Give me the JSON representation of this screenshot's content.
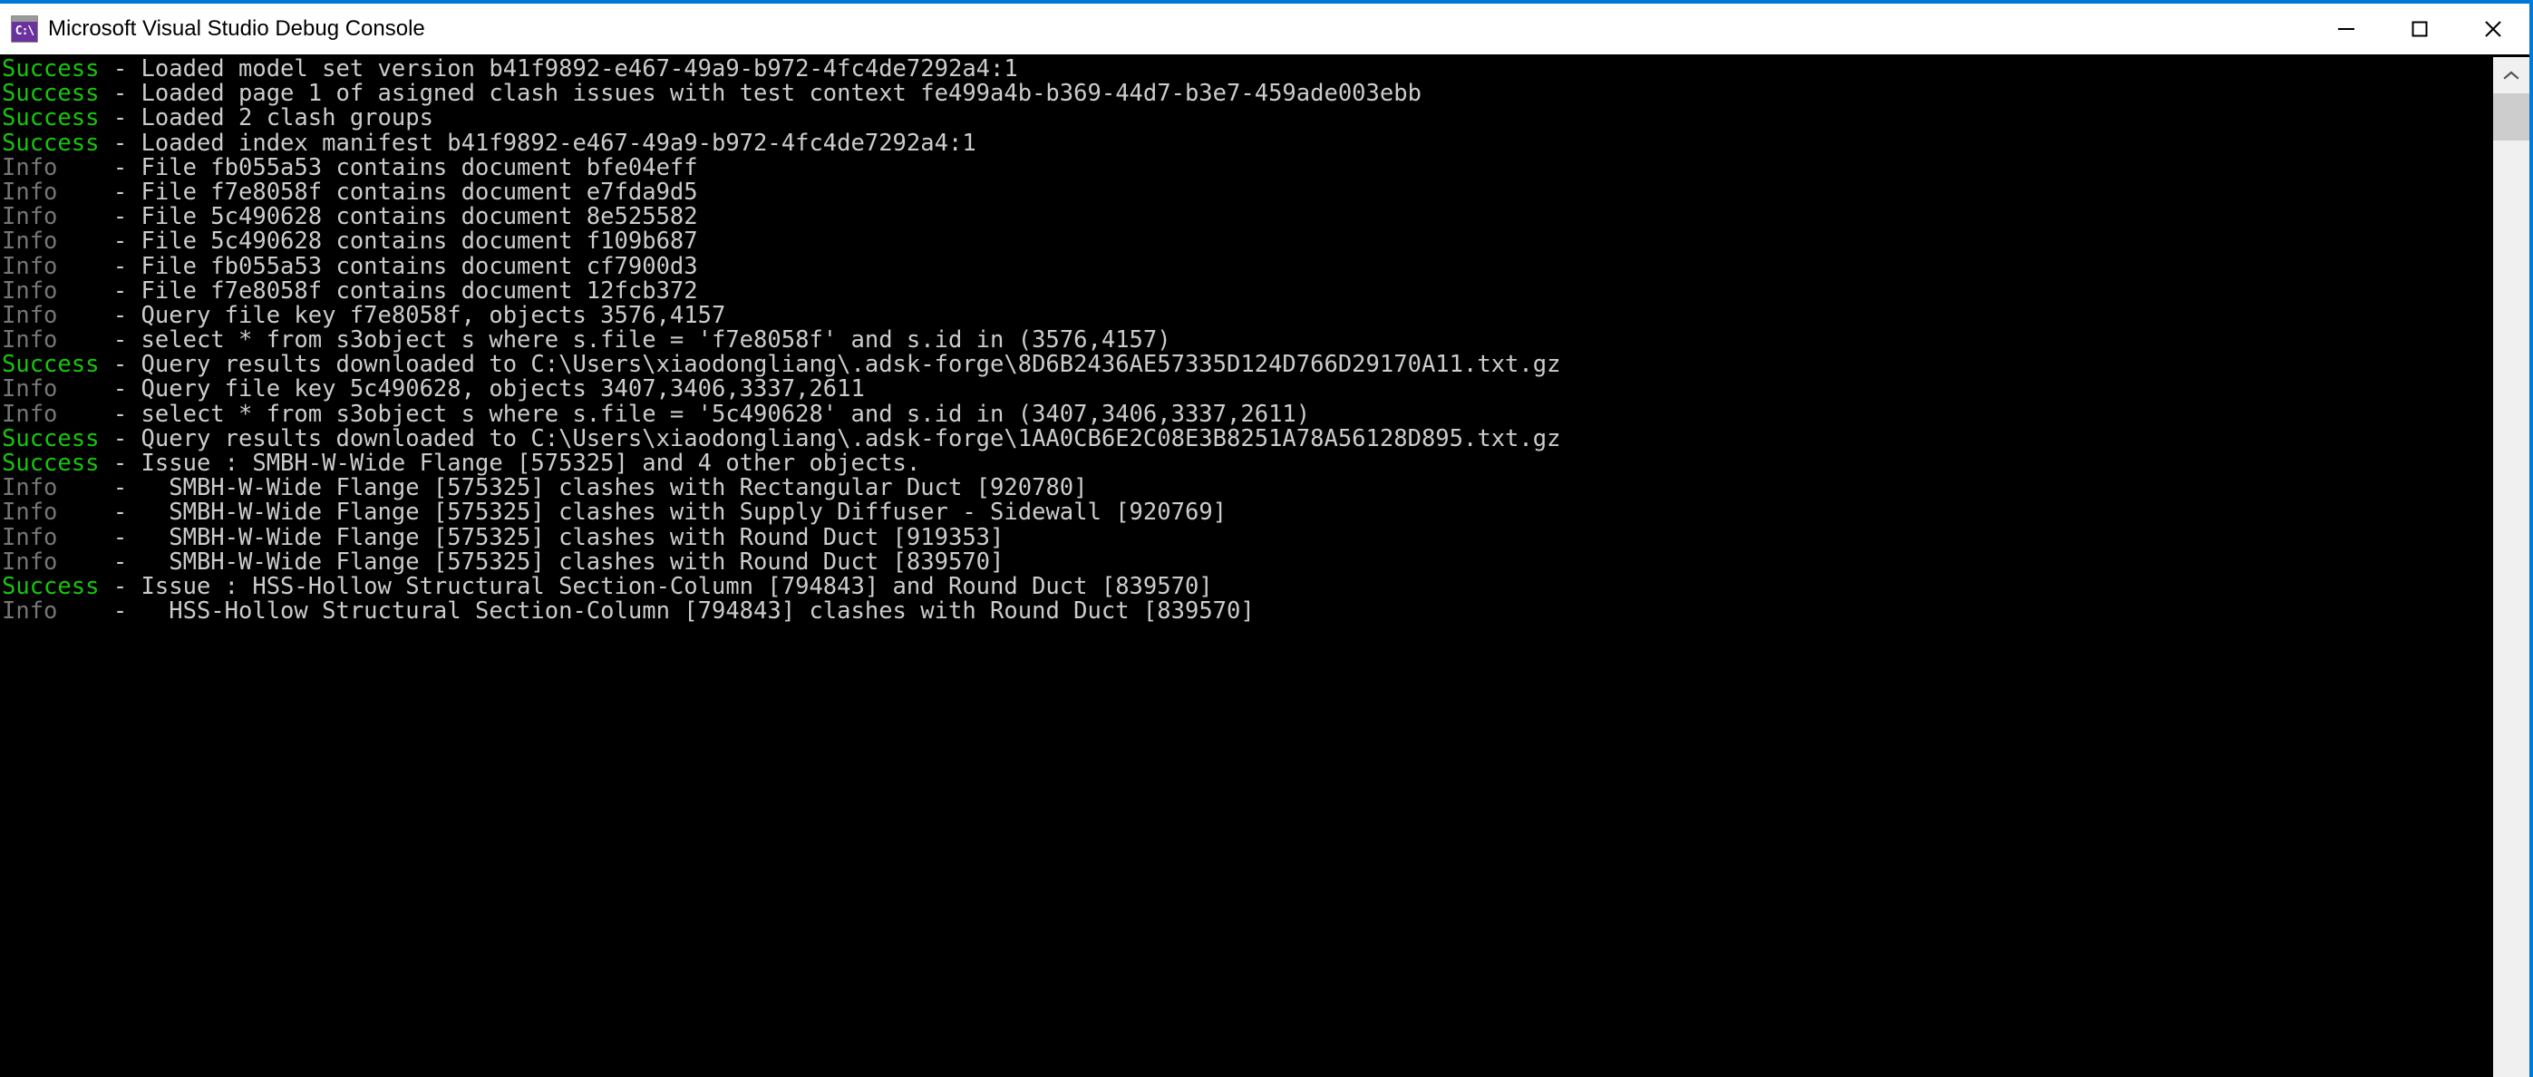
{
  "window": {
    "title": "Microsoft Visual Studio Debug Console",
    "icon_name": "console-app-icon",
    "icon_glyph": "C:\\",
    "accent_color": "#0078d7",
    "titlebar_bg": "#ffffff",
    "console_bg": "#000000"
  },
  "window_controls": {
    "minimize_label": "Minimize",
    "maximize_label": "Maximize",
    "close_label": "Close"
  },
  "console": {
    "colors": {
      "success": "#16c60c",
      "info": "#767676",
      "message": "#cccccc",
      "background": "#000000"
    },
    "lines": [
      {
        "level": "Success",
        "level_text": "Success",
        "sep": " - ",
        "message": "Loaded model set version b41f9892-e467-49a9-b972-4fc4de7292a4:1"
      },
      {
        "level": "Success",
        "level_text": "Success",
        "sep": " - ",
        "message": "Loaded page 1 of asigned clash issues with test context fe499a4b-b369-44d7-b3e7-459ade003ebb"
      },
      {
        "level": "Success",
        "level_text": "Success",
        "sep": " - ",
        "message": "Loaded 2 clash groups"
      },
      {
        "level": "Success",
        "level_text": "Success",
        "sep": " - ",
        "message": "Loaded index manifest b41f9892-e467-49a9-b972-4fc4de7292a4:1"
      },
      {
        "level": "Info",
        "level_text": "Info   ",
        "sep": " - ",
        "message": "File fb055a53 contains document bfe04eff"
      },
      {
        "level": "Info",
        "level_text": "Info   ",
        "sep": " - ",
        "message": "File f7e8058f contains document e7fda9d5"
      },
      {
        "level": "Info",
        "level_text": "Info   ",
        "sep": " - ",
        "message": "File 5c490628 contains document 8e525582"
      },
      {
        "level": "Info",
        "level_text": "Info   ",
        "sep": " - ",
        "message": "File 5c490628 contains document f109b687"
      },
      {
        "level": "Info",
        "level_text": "Info   ",
        "sep": " - ",
        "message": "File fb055a53 contains document cf7900d3"
      },
      {
        "level": "Info",
        "level_text": "Info   ",
        "sep": " - ",
        "message": "File f7e8058f contains document 12fcb372"
      },
      {
        "level": "Info",
        "level_text": "Info   ",
        "sep": " - ",
        "message": "Query file key f7e8058f, objects 3576,4157"
      },
      {
        "level": "Info",
        "level_text": "Info   ",
        "sep": " - ",
        "message": "select * from s3object s where s.file = 'f7e8058f' and s.id in (3576,4157)"
      },
      {
        "level": "Success",
        "level_text": "Success",
        "sep": " - ",
        "message": "Query results downloaded to C:\\Users\\xiaodongliang\\.adsk-forge\\8D6B2436AE57335D124D766D29170A11.txt.gz"
      },
      {
        "level": "Info",
        "level_text": "Info   ",
        "sep": " - ",
        "message": "Query file key 5c490628, objects 3407,3406,3337,2611"
      },
      {
        "level": "Info",
        "level_text": "Info   ",
        "sep": " - ",
        "message": "select * from s3object s where s.file = '5c490628' and s.id in (3407,3406,3337,2611)"
      },
      {
        "level": "Success",
        "level_text": "Success",
        "sep": " - ",
        "message": "Query results downloaded to C:\\Users\\xiaodongliang\\.adsk-forge\\1AA0CB6E2C08E3B8251A78A56128D895.txt.gz"
      },
      {
        "level": "Success",
        "level_text": "Success",
        "sep": " - ",
        "message": "Issue : SMBH-W-Wide Flange [575325] and 4 other objects."
      },
      {
        "level": "Info",
        "level_text": "Info   ",
        "sep": " -  ",
        "message": " SMBH-W-Wide Flange [575325] clashes with Rectangular Duct [920780]"
      },
      {
        "level": "Info",
        "level_text": "Info   ",
        "sep": " -  ",
        "message": " SMBH-W-Wide Flange [575325] clashes with Supply Diffuser - Sidewall [920769]"
      },
      {
        "level": "Info",
        "level_text": "Info   ",
        "sep": " -  ",
        "message": " SMBH-W-Wide Flange [575325] clashes with Round Duct [919353]"
      },
      {
        "level": "Info",
        "level_text": "Info   ",
        "sep": " -  ",
        "message": " SMBH-W-Wide Flange [575325] clashes with Round Duct [839570]"
      },
      {
        "level": "Success",
        "level_text": "Success",
        "sep": " - ",
        "message": "Issue : HSS-Hollow Structural Section-Column [794843] and Round Duct [839570]"
      },
      {
        "level": "Info",
        "level_text": "Info   ",
        "sep": " -  ",
        "message": " HSS-Hollow Structural Section-Column [794843] clashes with Round Duct [839570]"
      }
    ]
  },
  "scrollbar": {
    "up_arrow_name": "chevron-up-icon",
    "thumb_position_pct": 0,
    "track_color": "#f0f0f0",
    "thumb_color": "#cdcdcd"
  }
}
